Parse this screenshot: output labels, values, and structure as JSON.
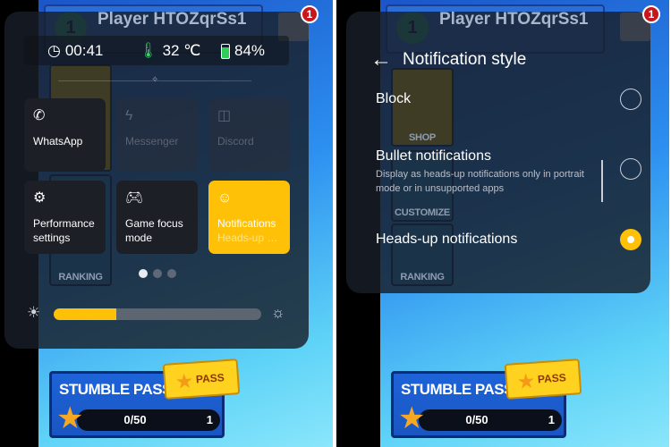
{
  "game": {
    "player_name": "Player HTOZqrSs1",
    "level": "1",
    "notification_badge": "1",
    "tiles": [
      "SHOP",
      "CUSTOMIZE",
      "RANKING"
    ],
    "pass_title": "STUMBLE PASS",
    "pass_ticket": "PASS",
    "pass_progress": "0/50",
    "pass_level": "1"
  },
  "left": {
    "status": {
      "time": "00:41",
      "temperature": "32 ℃",
      "battery": "84%"
    },
    "cards": [
      {
        "label": "WhatsApp",
        "icon": "whatsapp-icon",
        "enabled": true
      },
      {
        "label": "Messenger",
        "icon": "messenger-icon",
        "enabled": false
      },
      {
        "label": "Discord",
        "icon": "discord-icon",
        "enabled": false
      },
      {
        "label": "Performance settings",
        "icon": "performance-icon",
        "enabled": true
      },
      {
        "label": "Game focus mode",
        "icon": "gamepad-icon",
        "enabled": true
      },
      {
        "label": "Notifications",
        "sub": "Heads-up n...",
        "icon": "notification-icon",
        "active": true
      }
    ],
    "page_indicator": {
      "pages": 3,
      "current": 1
    },
    "brightness_percent": 30,
    "accent": "#ffc107"
  },
  "right": {
    "title": "Notification style",
    "options": [
      {
        "label": "Block",
        "selected": false
      },
      {
        "label": "Bullet notifications",
        "description": "Display as heads-up notifications only in portrait mode or in unsupported apps",
        "selected": false
      },
      {
        "label": "Heads-up notifications",
        "selected": true
      }
    ]
  }
}
